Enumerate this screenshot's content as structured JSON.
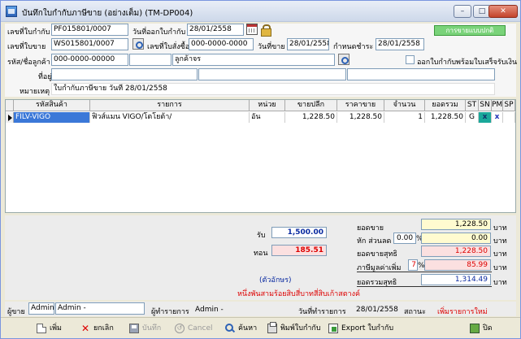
{
  "window": {
    "title": "บันทึกใบกำกับภาษีขาย (อย่างเต็ม) (TM-DP004)",
    "min": "–",
    "max": "□",
    "close": "✕"
  },
  "header": {
    "invoice_no_label": "เลขที่ใบกำกับ",
    "invoice_no": "PF015801/0007",
    "invoice_date_label": "วันที่ออกใบกำกับ",
    "invoice_date": "28/01/2558",
    "mode_badge": "การขายแบบปกติ",
    "sale_no_label": "เลขที่ใบขาย",
    "sale_no": "WS015801/0007",
    "po_no_label": "เลขที่ใบสั่งซื้อ",
    "po_no": "000-0000-0000",
    "sale_date_label": "วันที่ขาย",
    "sale_date": "28/01/2558",
    "due_date_label": "กำหนดชำระ",
    "due_date": "28/01/2558",
    "customer_code_label": "รหัส/ชื่อลูกค้า",
    "customer_code": "000-0000-00000",
    "customer_name": "",
    "customer_type": "ลูกค้าจร",
    "print_receipt_label": "ออกใบกำกับพร้อมใบเสร็จรับเงิน",
    "address_label": "ที่อยู่",
    "remark_label": "หมายเหตุ",
    "remark": "ใบกำกับภาษีขาย วันที่ 28/01/2558"
  },
  "grid": {
    "columns": [
      "รหัสสินค้า",
      "รายการ",
      "หน่วย",
      "ขายปลีก",
      "ราคาขาย",
      "จำนวน",
      "ยอดรวม",
      "ST",
      "SN",
      "PM",
      "SP"
    ],
    "rows": [
      {
        "code": "FILV-VIGO",
        "desc": "ฟิวส์แมน VIGO/โตโยต้า/",
        "unit": "อัน",
        "retail": "1,228.50",
        "price": "1,228.50",
        "qty": "1",
        "total": "1,228.50",
        "st": "G",
        "sn": "x",
        "pm": "x",
        "sp": ""
      }
    ]
  },
  "summary": {
    "receive_label": "รับ",
    "receive": "1,500.00",
    "change_label": "ทอน",
    "change": "185.51",
    "words_label": "(ตัวอักษร)",
    "amount_words": "หนึ่งพันสามร้อยสิบสี่บาทสี่สิบเก้าสตางค์",
    "subtotal_label": "ยอดขาย",
    "subtotal": "1,228.50",
    "discount_label": "หัก ส่วนลด",
    "discount_pct": "0.00",
    "pct_sign": "%",
    "discount": "0.00",
    "net_label": "ยอดขายสุทธิ",
    "net": "1,228.50",
    "vat_label": "ภาษีมูลค่าเพิ่ม",
    "vat_pct": "7",
    "vat": "85.99",
    "grand_label": "ยอดรวมสุทธิ",
    "grand": "1,314.49",
    "baht": "บาท"
  },
  "footer": {
    "seller_label": "ผู้ขาย",
    "seller_code": "Admin",
    "seller_name": "Admin -",
    "operator_label": "ผู้ทำรายการ",
    "operator": "Admin -",
    "op_date_label": "วันที่ทำรายการ",
    "op_date": "28/01/2558",
    "status_label": "สถานะ",
    "status": "เพิ่มรายการใหม่"
  },
  "toolbar": {
    "new": "เพิ่ม",
    "cancel_doc": "ยกเลิก",
    "save": "บันทึก",
    "cancel": "Cancel",
    "find": "ค้นหา",
    "print": "พิมพ์ใบกำกับ",
    "export": "Export ใบกำกับ",
    "close": "ปิด"
  },
  "colors": {
    "badge": "#7ad37a",
    "selected_row": "#3b78d8",
    "status_red": "#dd0000"
  }
}
